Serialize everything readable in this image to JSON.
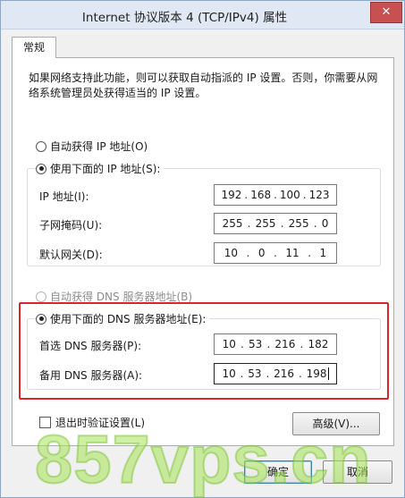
{
  "window": {
    "title": "Internet 协议版本 4 (TCP/IPv4) 属性",
    "close_glyph": "✕"
  },
  "tabs": [
    {
      "label": "常规",
      "active": true
    }
  ],
  "description": "如果网络支持此功能，则可以获取自动指派的 IP 设置。否则，你需要从网络系统管理员处获得适当的 IP 设置。",
  "ip_section": {
    "auto_option": {
      "label": "自动获得 IP 地址(O)",
      "checked": false
    },
    "manual_option": {
      "label": "使用下面的 IP 地址(S):",
      "checked": true
    },
    "fields": [
      {
        "label": "IP 地址(I):",
        "octets": [
          "192",
          "168",
          "100",
          "123"
        ]
      },
      {
        "label": "子网掩码(U):",
        "octets": [
          "255",
          "255",
          "255",
          "0"
        ]
      },
      {
        "label": "默认网关(D):",
        "octets": [
          "10",
          "0",
          "11",
          "1"
        ]
      }
    ]
  },
  "dns_section": {
    "auto_option": {
      "label": "自动获得 DNS 服务器地址(B)",
      "checked": false,
      "disabled": true
    },
    "manual_option": {
      "label": "使用下面的 DNS 服务器地址(E):",
      "checked": true
    },
    "fields": [
      {
        "label": "首选 DNS 服务器(P):",
        "octets": [
          "10",
          "53",
          "216",
          "182"
        ]
      },
      {
        "label": "备用 DNS 服务器(A):",
        "octets": [
          "10",
          "53",
          "216",
          "198"
        ],
        "focused": true
      }
    ],
    "highlight_color": "#d9252b"
  },
  "validate_checkbox": {
    "label": "退出时验证设置(L)",
    "checked": false
  },
  "buttons": {
    "advanced": "高级(V)...",
    "ok": "确定",
    "cancel": "取消"
  },
  "watermark": "857vps.cn"
}
